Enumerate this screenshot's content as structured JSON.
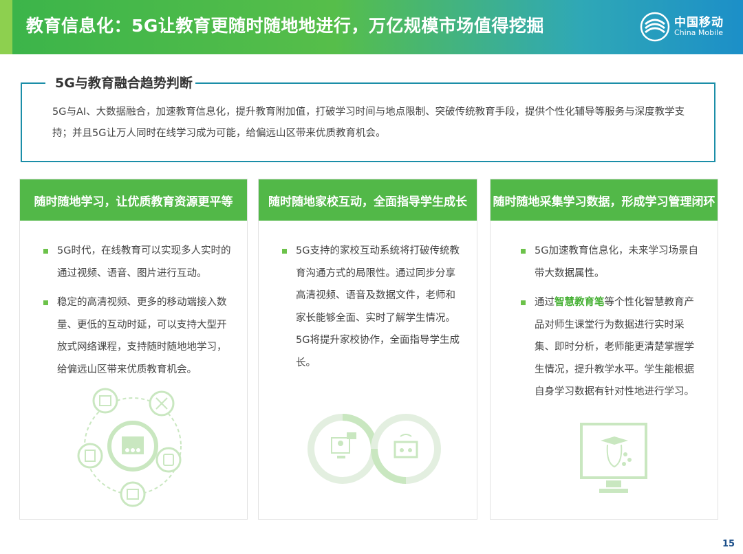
{
  "header": {
    "title": "教育信息化：5G让教育更随时随地地进行，万亿规模市场值得挖掘",
    "logo_cn": "中国移动",
    "logo_en": "China Mobile"
  },
  "summary": {
    "heading": "5G与教育融合趋势判断",
    "text": "5G与AI、大数据融合，加速教育信息化，提升教育附加值，打破学习时间与地点限制、突破传统教育手段，提供个性化辅导等服务与深度教学支持；并且5G让万人同时在线学习成为可能，给偏远山区带来优质教育机会。"
  },
  "cards": [
    {
      "title": "随时随地学习，让优质教育资源更平等",
      "bullets": [
        "5G时代，在线教育可以实现多人实时的通过视频、语音、图片进行互动。",
        "稳定的高清视频、更多的移动端接入数量、更低的互动时延，可以支持大型开放式网络课程，支持随时随地地学习，给偏远山区带来优质教育机会。"
      ]
    },
    {
      "title": "随时随地家校互动，全面指导学生成长",
      "bullets": [
        "5G支持的家校互动系统将打破传统教育沟通方式的局限性。通过同步分享高清视频、语音及数据文件，老师和家长能够全面、实时了解学生情况。5G将提升家校协作，全面指导学生成长。"
      ]
    },
    {
      "title": "随时随地采集学习数据，形成学习管理闭环",
      "bullets": [
        "5G加速教育信息化，未来学习场景自带大数据属性。"
      ],
      "bullet2_pre": "通过",
      "bullet2_hl": "智慧教育笔",
      "bullet2_post": "等个性化智慧教育产品对师生课堂行为数据进行实时采集、即时分析，老师能更清楚掌握学生情况，提升教学水平。学生能根据自身学习数据有针对性地进行学习。"
    }
  ],
  "page_number": "15",
  "colors": {
    "accent_green": "#52b848",
    "accent_teal": "#1b8ea8",
    "illustration_green": "#c9e7c0"
  }
}
